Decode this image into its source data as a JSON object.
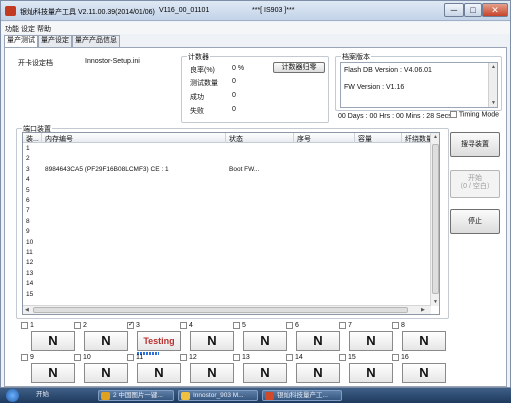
{
  "window": {
    "title": "银灿科技量产工具 V2.11.00.39(2014/01/06)",
    "version_tag": "V116_00_01101",
    "device_tag": "***[ IS903 ]***",
    "minimize": "─",
    "maximize": "□",
    "close": "✕"
  },
  "menu": [
    "功能",
    "设定",
    "帮助"
  ],
  "tabs": [
    "量产测试",
    "量产设定",
    "量产产品信息"
  ],
  "file": {
    "label": "开卡设定档",
    "value": "Innostor-Setup.ini"
  },
  "counter": {
    "title": "计数器",
    "rows": [
      {
        "label": "良率(%)",
        "value": "0 %"
      },
      {
        "label": "测试数量",
        "value": "0"
      },
      {
        "label": "成功",
        "value": "0"
      },
      {
        "label": "失败",
        "value": "0"
      }
    ],
    "reset_button": "计数器归零"
  },
  "version_group": {
    "title": "档案版本",
    "flash_db": "Flash DB Version :  V4.06.01",
    "fw": "FW Version :  V1.16"
  },
  "elapsed": "00 Days : 00 Hrs : 00 Mins : 28 Secs",
  "timing_mode": "Timing Mode",
  "device_list": {
    "title": "端口装置",
    "columns": [
      "装...",
      "内存编号",
      "状态",
      "序号",
      "容量",
      "纤绕数量"
    ],
    "rows": [
      {
        "no": "1",
        "mem": "",
        "status": ""
      },
      {
        "no": "2",
        "mem": "",
        "status": ""
      },
      {
        "no": "3",
        "mem": "8984643CA5 (PF29F16B08LCMF3) CE : 1",
        "status": "Boot FW..."
      },
      {
        "no": "4",
        "mem": "",
        "status": ""
      },
      {
        "no": "5",
        "mem": "",
        "status": ""
      },
      {
        "no": "6",
        "mem": "",
        "status": ""
      },
      {
        "no": "7",
        "mem": "",
        "status": ""
      },
      {
        "no": "8",
        "mem": "",
        "status": ""
      },
      {
        "no": "9",
        "mem": "",
        "status": ""
      },
      {
        "no": "10",
        "mem": "",
        "status": ""
      },
      {
        "no": "11",
        "mem": "",
        "status": ""
      },
      {
        "no": "12",
        "mem": "",
        "status": ""
      },
      {
        "no": "13",
        "mem": "",
        "status": ""
      },
      {
        "no": "14",
        "mem": "",
        "status": ""
      },
      {
        "no": "15",
        "mem": "",
        "status": ""
      }
    ]
  },
  "side_buttons": {
    "rescan": "搜寻装置",
    "start_line1": "开始",
    "start_line2": "（0 / 空白）",
    "stop": "停止"
  },
  "ports": [
    {
      "num": "1",
      "checked": false,
      "status": "N"
    },
    {
      "num": "2",
      "checked": false,
      "status": "N"
    },
    {
      "num": "3",
      "checked": true,
      "status": "Testing"
    },
    {
      "num": "4",
      "checked": false,
      "status": "N"
    },
    {
      "num": "5",
      "checked": false,
      "status": "N"
    },
    {
      "num": "6",
      "checked": false,
      "status": "N"
    },
    {
      "num": "7",
      "checked": false,
      "status": "N"
    },
    {
      "num": "8",
      "checked": false,
      "status": "N"
    },
    {
      "num": "9",
      "checked": false,
      "status": "N"
    },
    {
      "num": "10",
      "checked": false,
      "status": "N"
    },
    {
      "num": "11",
      "checked": false,
      "status": "N"
    },
    {
      "num": "12",
      "checked": false,
      "status": "N"
    },
    {
      "num": "13",
      "checked": false,
      "status": "N"
    },
    {
      "num": "14",
      "checked": false,
      "status": "N"
    },
    {
      "num": "15",
      "checked": false,
      "status": "N"
    },
    {
      "num": "16",
      "checked": false,
      "status": "N"
    }
  ],
  "taskbar": {
    "items": [
      {
        "label": "开始",
        "icon": "windows-orb-icon",
        "color": "#3a78c8"
      },
      {
        "label": "2 中国图片一键...",
        "icon": "chrome-icon",
        "color": "#e0a020"
      },
      {
        "label": "Innostor_903 M...",
        "icon": "folder-icon",
        "color": "#f0c040"
      },
      {
        "label": "银灿科技量产工...",
        "icon": "app-icon",
        "color": "#d04a2a"
      }
    ]
  },
  "colors": {
    "accent_blue": "#2e6fd8",
    "testing_red": "#b8312f"
  }
}
